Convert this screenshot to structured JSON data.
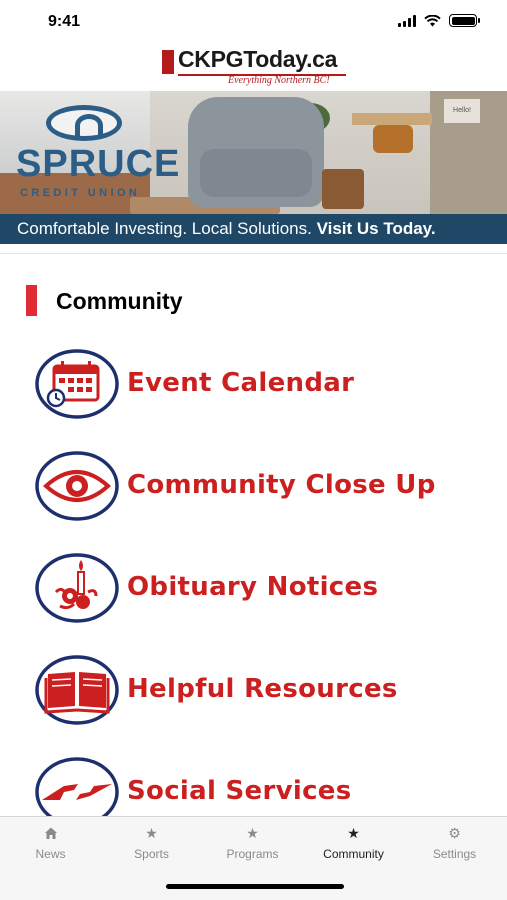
{
  "status_bar": {
    "time": "9:41"
  },
  "header": {
    "logo_text": "CKPGToday.ca",
    "logo_tagline": "Everything Northern BC!"
  },
  "banner": {
    "brand_name": "SPRUCE",
    "brand_sub": "CREDIT UNION",
    "sign_text": "Hello!",
    "strip_text": "Comfortable Investing. Local Solutions.",
    "strip_cta": "Visit Us Today."
  },
  "section": {
    "title": "Community"
  },
  "menu": {
    "items": [
      {
        "label": "Event Calendar",
        "icon": "calendar-icon"
      },
      {
        "label": "Community Close Up",
        "icon": "eye-icon"
      },
      {
        "label": "Obituary Notices",
        "icon": "candle-rose-icon"
      },
      {
        "label": "Helpful Resources",
        "icon": "book-icon"
      },
      {
        "label": "Social Services",
        "icon": "helping-hands-icon"
      }
    ]
  },
  "tabs": [
    {
      "label": "News",
      "icon": "home-icon",
      "active": false
    },
    {
      "label": "Sports",
      "icon": "star-icon",
      "active": false
    },
    {
      "label": "Programs",
      "icon": "star-icon",
      "active": false
    },
    {
      "label": "Community",
      "icon": "star-icon",
      "active": true
    },
    {
      "label": "Settings",
      "icon": "gear-icon",
      "active": false
    }
  ],
  "colors": {
    "accent_red": "#cc1f1f",
    "icon_navy": "#1e2f6e",
    "section_bar": "#e02a34",
    "banner_blue": "#1f4766"
  }
}
